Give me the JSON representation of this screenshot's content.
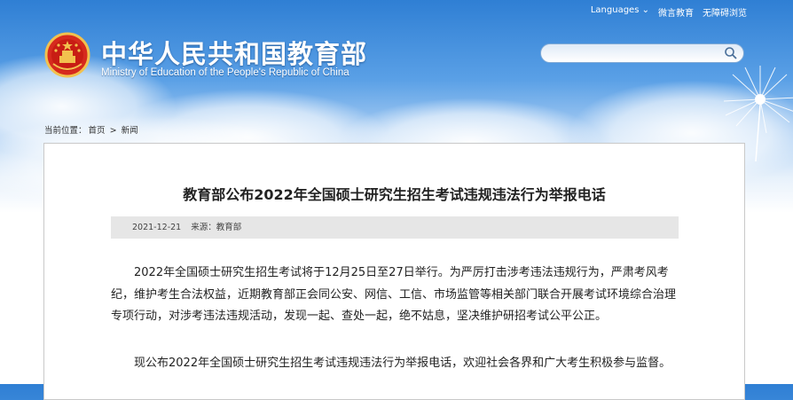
{
  "header": {
    "languages_label": "Languages",
    "link_mobile": "微言教育",
    "link_accessible": "无障碍浏览",
    "title_cn": "中华人民共和国教育部",
    "title_en": "Ministry of Education of the People's Republic of China"
  },
  "search": {
    "placeholder": ""
  },
  "breadcrumb": {
    "prefix": "当前位置：",
    "home": "首页",
    "sep": ">",
    "current": "新闻"
  },
  "article": {
    "title": "教育部公布2022年全国硕士研究生招生考试违规违法行为举报电话",
    "date": "2021-12-21",
    "source": "来源：教育部",
    "paragraphs": [
      "2022年全国硕士研究生招生考试将于12月25日至27日举行。为严厉打击涉考违法违规行为，严肃考风考纪，维护考生合法权益，近期教育部正会同公安、网信、工信、市场监管等相关部门联合开展考试环境综合治理专项行动，对涉考违法违规活动，发现一起、查处一起，绝不姑息，坚决维护研招考试公平公正。",
      "现公布2022年全国硕士研究生招生考试违规违法行为举报电话，欢迎社会各界和广大考生积极参与监督。"
    ]
  }
}
